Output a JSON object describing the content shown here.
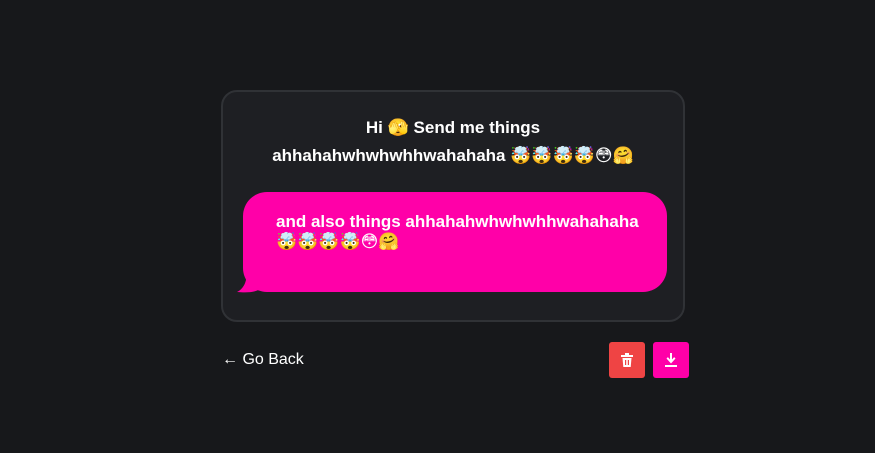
{
  "question": {
    "line1": "Hi 🫣 Send me things",
    "line2": "ahhahahwhwhwhhwahahaha 🤯🤯🤯🤯😳🤗"
  },
  "reply": {
    "text": "and also things ahhahahwhwhwhhwahahaha 🤯🤯🤯🤯😳🤗"
  },
  "navigation": {
    "back_label": "← Go Back"
  },
  "colors": {
    "background": "#17181b",
    "card": "#1e1f23",
    "accent": "#ff00a8",
    "danger": "#ef4444"
  },
  "icons": {
    "delete": "trash-icon",
    "download": "download-icon"
  }
}
